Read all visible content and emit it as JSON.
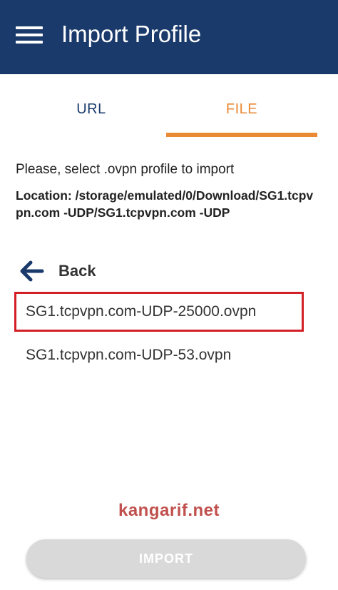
{
  "app_bar": {
    "title": "Import Profile",
    "menu_icon": "hamburger-menu-icon",
    "background_color": "#1a3a6b"
  },
  "tabs": [
    {
      "label": "URL",
      "selected": false
    },
    {
      "label": "FILE",
      "selected": true
    }
  ],
  "accent_color": "#ea8a34",
  "content": {
    "instruction": "Please, select .ovpn profile to import",
    "location": "Location: /storage/emulated/0/Download/SG1.tcpvpn.com -UDP/SG1.tcpvpn.com -UDP"
  },
  "back": {
    "label": "Back",
    "icon": "arrow-left-icon"
  },
  "files": [
    {
      "name": "SG1.tcpvpn.com-UDP-25000.ovpn",
      "highlighted": true
    },
    {
      "name": "SG1.tcpvpn.com-UDP-53.ovpn",
      "highlighted": false
    }
  ],
  "highlight_color": "#d32027",
  "watermark": "kangarif.net",
  "import_button": {
    "label": "IMPORT",
    "enabled": false
  }
}
